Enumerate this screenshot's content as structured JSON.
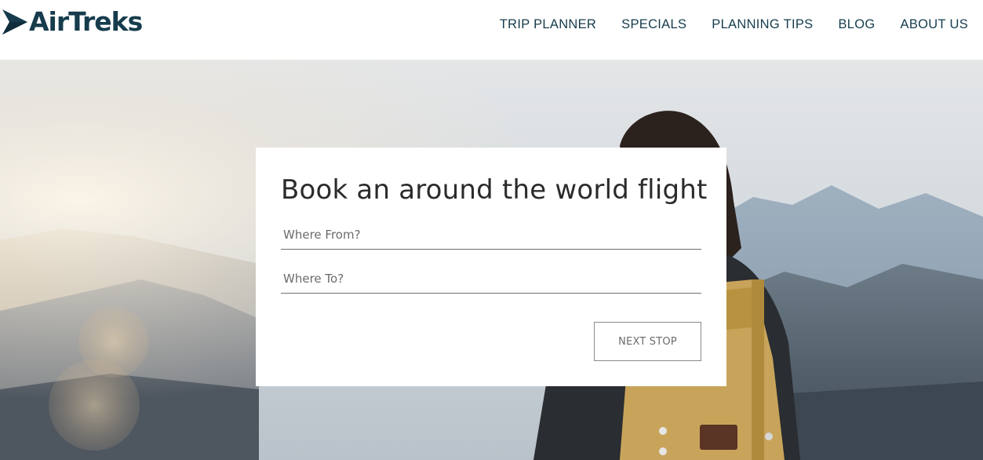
{
  "brand": {
    "name": "AirTreks",
    "color": "#163c4d"
  },
  "nav": {
    "items": [
      {
        "label": "TRIP PLANNER"
      },
      {
        "label": "SPECIALS"
      },
      {
        "label": "PLANNING TIPS"
      },
      {
        "label": "BLOG"
      },
      {
        "label": "ABOUT US"
      }
    ]
  },
  "booking": {
    "title": "Book an around the world flight",
    "from": {
      "placeholder": "Where From?",
      "value": ""
    },
    "to": {
      "placeholder": "Where To?",
      "value": ""
    },
    "submit_label": "NEXT STOP"
  },
  "hero": {
    "image_description_icon": "hiker-mountain-photo"
  }
}
